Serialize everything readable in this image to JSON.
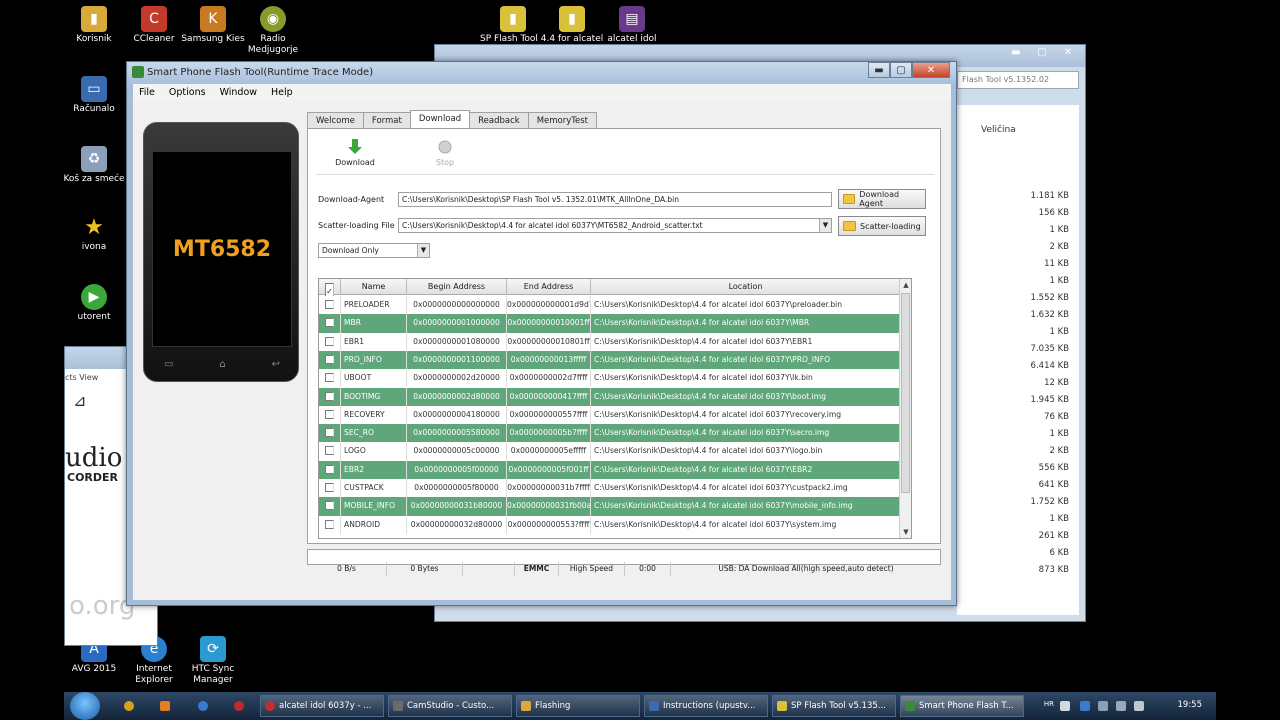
{
  "desktop": {
    "icons": [
      {
        "label": "Korisnik",
        "color": "#d9a93a"
      },
      {
        "label": "CCleaner",
        "color": "#c23b2a"
      },
      {
        "label": "Samsung Kies",
        "color": "#c77a20"
      },
      {
        "label": "Radio Medjugorje",
        "color": "#8a9a2a"
      },
      {
        "label": "SP Flash Tool 4.4 for alcatel",
        "color": "#d9c13a"
      },
      {
        "label": "alcatel idol",
        "color": "#d9c13a"
      },
      {
        "label": "Računalo",
        "color": "#3a6ab0"
      },
      {
        "label": "Koš za smeće",
        "color": "#8aa0b8"
      },
      {
        "label": "ivona",
        "color": "#e8c020"
      },
      {
        "label": "utorent",
        "color": "#3aa83a"
      },
      {
        "label": "AVG 2015",
        "color": "#2a6ac0"
      },
      {
        "label": "Internet Explorer",
        "color": "#2a80d0"
      },
      {
        "label": "HTC Sync Manager",
        "color": "#2a9ad0"
      }
    ]
  },
  "background_window": {
    "address": "Flash Tool v5.1352.02",
    "column": "Veličina",
    "sizes": [
      "1.181 KB",
      "156 KB",
      "1 KB",
      "2 KB",
      "11 KB",
      "1 KB",
      "1.552 KB",
      "1.632 KB",
      "1 KB",
      "7.035 KB",
      "6.414 KB",
      "12 KB",
      "1.945 KB",
      "76 KB",
      "1 KB",
      "2 KB",
      "556 KB",
      "641 KB",
      "1.752 KB",
      "1 KB",
      "261 KB",
      "6 KB",
      "873 KB"
    ]
  },
  "left_window": {
    "menu": "cts   View",
    "brand": "udio",
    "brand_sub": "CORDER",
    "watermark": "o.org"
  },
  "app": {
    "title": "Smart Phone Flash Tool(Runtime Trace Mode)",
    "menu": [
      "File",
      "Options",
      "Window",
      "Help"
    ],
    "phone_chip": "MT6582",
    "tabs": [
      "Welcome",
      "Format",
      "Download",
      "Readback",
      "MemoryTest"
    ],
    "active_tab": "Download",
    "toolbar": {
      "download": "Download",
      "stop": "Stop"
    },
    "download_agent_label": "Download-Agent",
    "download_agent_value": "C:\\Users\\Korisnik\\Desktop\\SP Flash Tool v5. 1352.01\\MTK_AllInOne_DA.bin",
    "download_agent_button": "Download Agent",
    "scatter_label": "Scatter-loading File",
    "scatter_value": "C:\\Users\\Korisnik\\Desktop\\4.4 for alcatel idol 6037Y\\MT6582_Android_scatter.txt",
    "scatter_button": "Scatter-loading",
    "mode": "Download Only",
    "columns": [
      "Name",
      "Begin Address",
      "End Address",
      "Location"
    ],
    "rows": [
      {
        "name": "PRELOADER",
        "begin": "0x0000000000000000",
        "end": "0x000000000001d9d7",
        "loc": "C:\\Users\\Korisnik\\Desktop\\4.4 for alcatel idol 6037Y\\preloader.bin",
        "style": "w"
      },
      {
        "name": "MBR",
        "begin": "0x0000000001000000",
        "end": "0x00000000010001ff",
        "loc": "C:\\Users\\Korisnik\\Desktop\\4.4 for alcatel idol 6037Y\\MBR",
        "style": "g"
      },
      {
        "name": "EBR1",
        "begin": "0x0000000001080000",
        "end": "0x00000000010801ff",
        "loc": "C:\\Users\\Korisnik\\Desktop\\4.4 for alcatel idol 6037Y\\EBR1",
        "style": "w"
      },
      {
        "name": "PRO_INFO",
        "begin": "0x0000000001100000",
        "end": "0x00000000013fffff",
        "loc": "C:\\Users\\Korisnik\\Desktop\\4.4 for alcatel idol 6037Y\\PRO_INFO",
        "style": "g"
      },
      {
        "name": "UBOOT",
        "begin": "0x0000000002d20000",
        "end": "0x0000000002d7ffff",
        "loc": "C:\\Users\\Korisnik\\Desktop\\4.4 for alcatel idol 6037Y\\lk.bin",
        "style": "w"
      },
      {
        "name": "BOOTIMG",
        "begin": "0x0000000002d80000",
        "end": "0x000000000417ffff",
        "loc": "C:\\Users\\Korisnik\\Desktop\\4.4 for alcatel idol 6037Y\\boot.img",
        "style": "g"
      },
      {
        "name": "RECOVERY",
        "begin": "0x0000000004180000",
        "end": "0x000000000557ffff",
        "loc": "C:\\Users\\Korisnik\\Desktop\\4.4 for alcatel idol 6037Y\\recovery.img",
        "style": "w"
      },
      {
        "name": "SEC_RO",
        "begin": "0x0000000005580000",
        "end": "0x0000000005b7ffff",
        "loc": "C:\\Users\\Korisnik\\Desktop\\4.4 for alcatel idol 6037Y\\secro.img",
        "style": "g"
      },
      {
        "name": "LOGO",
        "begin": "0x0000000005c00000",
        "end": "0x0000000005efffff",
        "loc": "C:\\Users\\Korisnik\\Desktop\\4.4 for alcatel idol 6037Y\\logo.bin",
        "style": "w"
      },
      {
        "name": "EBR2",
        "begin": "0x0000000005f00000",
        "end": "0x0000000005f001ff",
        "loc": "C:\\Users\\Korisnik\\Desktop\\4.4 for alcatel idol 6037Y\\EBR2",
        "style": "g"
      },
      {
        "name": "CUSTPACK",
        "begin": "0x0000000005f80000",
        "end": "0x00000000031b7ffff",
        "loc": "C:\\Users\\Korisnik\\Desktop\\4.4 for alcatel idol 6037Y\\custpack2.img",
        "style": "w"
      },
      {
        "name": "MOBILE_INFO",
        "begin": "0x00000000031b80000",
        "end": "0x00000000031fb00ab",
        "loc": "C:\\Users\\Korisnik\\Desktop\\4.4 for alcatel idol 6037Y\\mobile_info.img",
        "style": "g"
      },
      {
        "name": "ANDROID",
        "begin": "0x00000000032d80000",
        "end": "0x000000000553?ffff",
        "loc": "C:\\Users\\Korisnik\\Desktop\\4.4 for alcatel idol 6037Y\\system.img",
        "style": "w"
      }
    ],
    "status": [
      "0 B/s",
      "0 Bytes",
      "",
      "EMMC",
      "High Speed",
      "0:00",
      "USB: DA Download All(high speed,auto detect)"
    ]
  },
  "taskbar": {
    "tasks": [
      {
        "label": "alcatel idol 6037y - ...",
        "color": "#c0302a"
      },
      {
        "label": "CamStudio - Custo...",
        "color": "#6a6a6a"
      },
      {
        "label": "Flashing",
        "color": "#d9a93a"
      },
      {
        "label": "Instructions (upustv...",
        "color": "#3a6ab0"
      },
      {
        "label": "SP Flash Tool v5.135...",
        "color": "#d9c13a"
      },
      {
        "label": "Smart Phone Flash T...",
        "color": "#3a8a3a"
      }
    ],
    "lang": "HR",
    "clock": "19:55"
  }
}
